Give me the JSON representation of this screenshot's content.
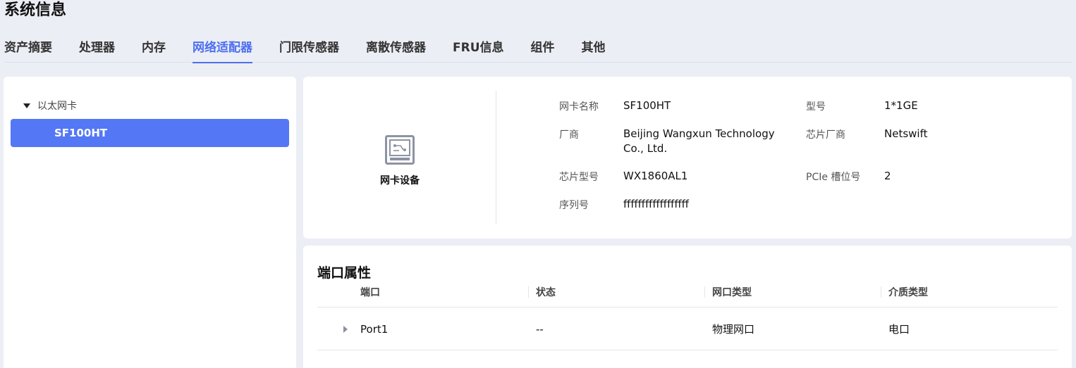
{
  "page": {
    "title": "系统信息"
  },
  "tabs": [
    {
      "label": "资产摘要"
    },
    {
      "label": "处理器"
    },
    {
      "label": "内存"
    },
    {
      "label": "网络适配器",
      "active": true
    },
    {
      "label": "门限传感器"
    },
    {
      "label": "离散传感器"
    },
    {
      "label": "FRU信息"
    },
    {
      "label": "组件"
    },
    {
      "label": "其他"
    }
  ],
  "tree": {
    "group_label": "以太网卡",
    "items": [
      {
        "label": "SF100HT",
        "selected": true
      }
    ]
  },
  "device": {
    "icon": "network-card-icon",
    "label": "网卡设备",
    "fields": {
      "name_label": "网卡名称",
      "name_value": "SF100HT",
      "model_label": "型号",
      "model_value": "1*1GE",
      "vendor_label": "厂商",
      "vendor_value": "Beijing Wangxun Technology Co., Ltd.",
      "chip_vendor_label": "芯片厂商",
      "chip_vendor_value": "Netswift",
      "chip_model_label": "芯片型号",
      "chip_model_value": "WX1860AL1",
      "slot_label": "PCIe 槽位号",
      "slot_value": "2",
      "serial_label": "序列号",
      "serial_value": "ffffffffffffffffff"
    }
  },
  "ports": {
    "title": "端口属性",
    "columns": [
      "端口",
      "状态",
      "网口类型",
      "介质类型"
    ],
    "rows": [
      {
        "port": "Port1",
        "status": "--",
        "port_type": "物理网口",
        "media_type": "电口"
      }
    ]
  },
  "colors": {
    "accent": "#4d6ff0",
    "selected_bg": "#5477f5",
    "page_bg": "#eceef5"
  }
}
